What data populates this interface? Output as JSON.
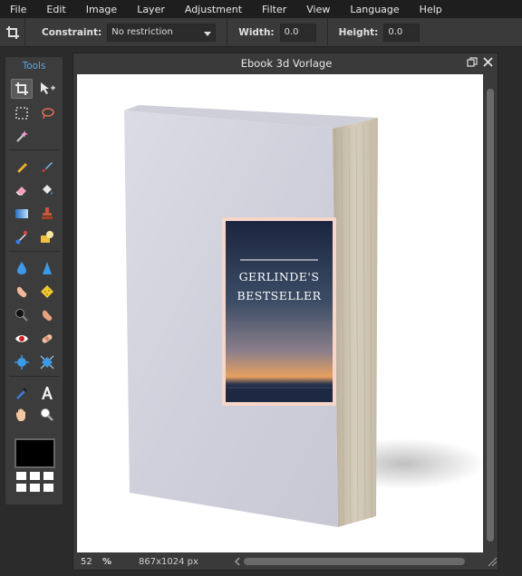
{
  "menu": [
    "File",
    "Edit",
    "Image",
    "Layer",
    "Adjustment",
    "Filter",
    "View",
    "Language",
    "Help"
  ],
  "options": {
    "constraint_label": "Constraint:",
    "constraint_value": "No restriction",
    "width_label": "Width:",
    "width_value": "0.0",
    "height_label": "Height:",
    "height_value": "0.0"
  },
  "tools": {
    "title": "Tools",
    "icons": [
      "crop-icon",
      "move-icon",
      "marquee-icon",
      "lasso-icon",
      "magic-wand-icon",
      "pencil-icon",
      "brush-icon",
      "eraser-icon",
      "paint-bucket-icon",
      "gradient-icon",
      "clone-stamp-icon",
      "color-replace-icon",
      "drawing-icon",
      "blur-icon",
      "sharpen-icon",
      "smudge-icon",
      "sponge-icon",
      "dodge-icon",
      "burn-icon",
      "red-eye-icon",
      "spot-heal-icon",
      "bloat-icon",
      "pinch-icon",
      "color-picker-icon",
      "type-icon",
      "hand-icon",
      "zoom-icon"
    ],
    "foreground_color": "#000000"
  },
  "document": {
    "title": "Ebook 3d Vorlage",
    "cover_line1": "GERLINDE'S",
    "cover_line2": "BESTSELLER",
    "zoom": "52",
    "zoom_unit": "%",
    "dimensions": "867x1024 px"
  },
  "colors": {
    "accent": "#5aa7e0",
    "menubar": "#1e1e1e",
    "panel": "#3c3c3c"
  }
}
